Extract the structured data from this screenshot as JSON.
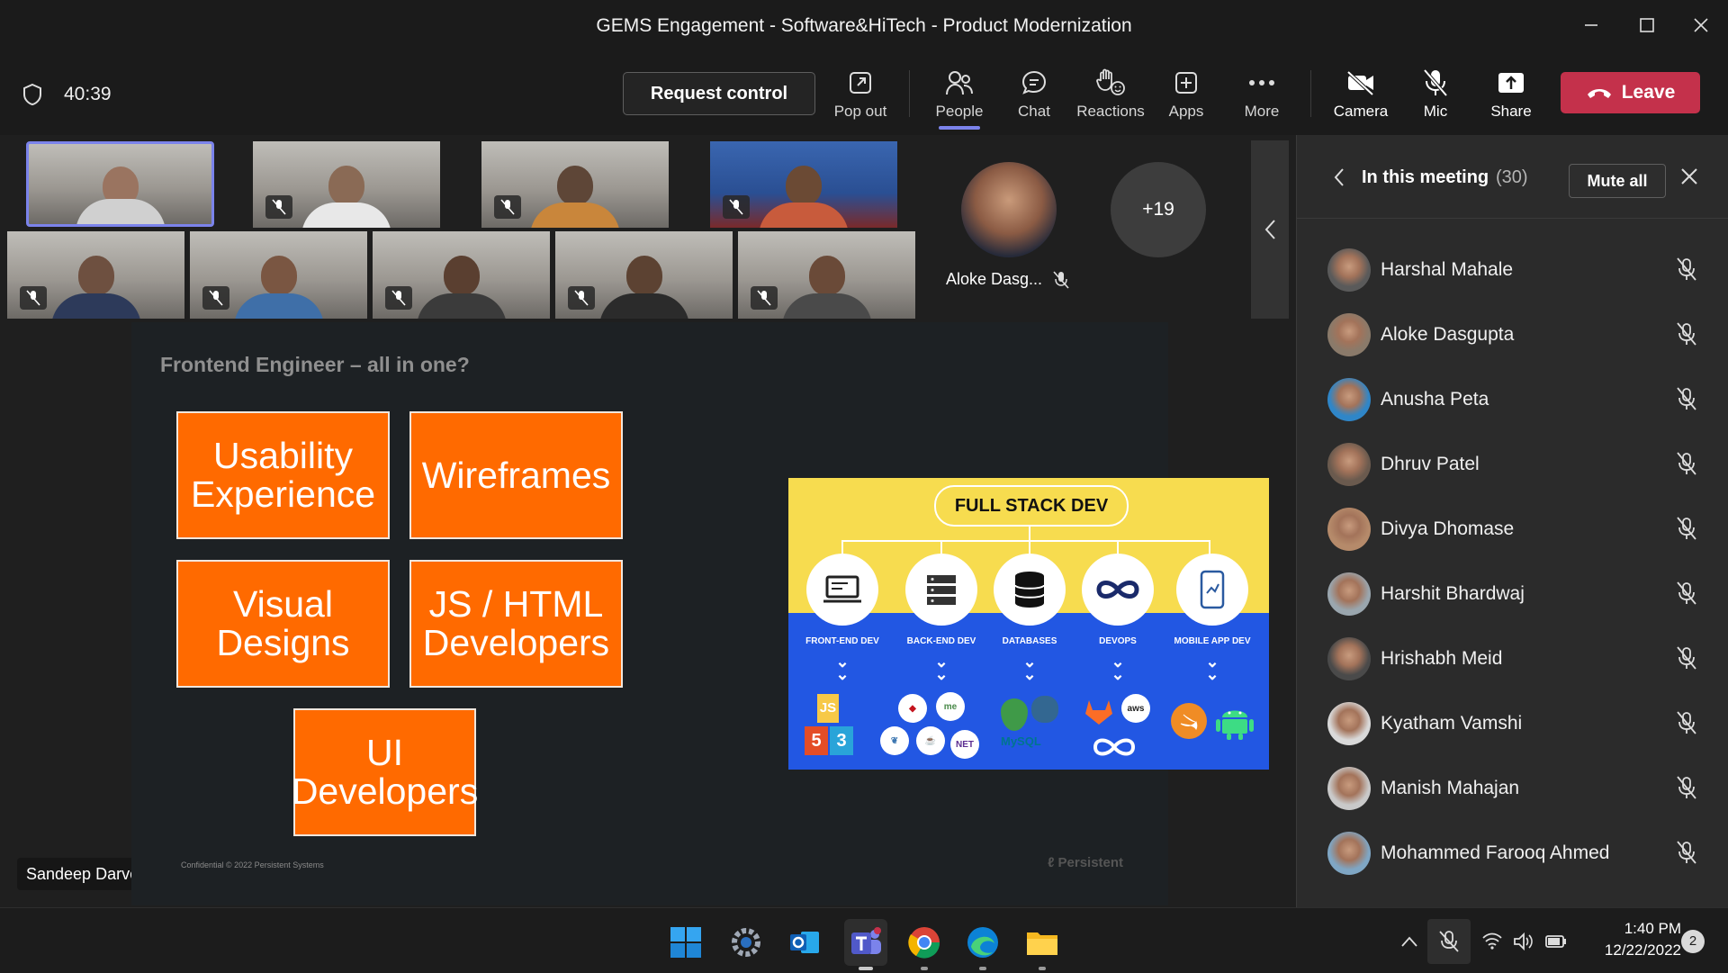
{
  "window": {
    "title": "GEMS Engagement - Software&HiTech - Product Modernization",
    "controls": [
      "minimize",
      "maximize",
      "close"
    ]
  },
  "toolbar": {
    "timer": "40:39",
    "request_control": "Request control",
    "items": [
      {
        "label": "Pop out",
        "icon": "pop-out-icon"
      },
      {
        "label": "People",
        "icon": "people-icon",
        "active": true
      },
      {
        "label": "Chat",
        "icon": "chat-icon"
      },
      {
        "label": "Reactions",
        "icon": "reactions-icon"
      },
      {
        "label": "Apps",
        "icon": "apps-icon"
      },
      {
        "label": "More",
        "icon": "more-icon"
      },
      {
        "label": "Camera",
        "icon": "camera-off-icon"
      },
      {
        "label": "Mic",
        "icon": "mic-off-icon"
      },
      {
        "label": "Share",
        "icon": "share-icon"
      }
    ],
    "leave": "Leave",
    "accent": "#7b83eb",
    "leave_color": "#c4314b"
  },
  "stage": {
    "featured_name": "Aloke Dasg...",
    "overflow_count": "+19",
    "presenter_name": "Sandeep Darvekar"
  },
  "slide": {
    "heading": "Frontend Engineer – all in one?",
    "boxes": [
      "Usability Experience",
      "Wireframes",
      "Visual Designs",
      "JS / HTML Developers",
      "UI Developers"
    ],
    "box_color": "#ff6a00",
    "full_stack": {
      "title": "FULL STACK DEV",
      "columns": [
        "FRONT-END DEV",
        "BACK-END DEV",
        "DATABASES",
        "DEVOPS",
        "MOBILE APP DEV"
      ],
      "logo_text": {
        "frontend_js": "JS",
        "frontend_html": "5",
        "frontend_css": "3",
        "dotnet": "NET",
        "mysql": "MySQL",
        "aws": "aws"
      }
    },
    "footer_left": "Confidential © 2022 Persistent Systems",
    "footer_brand": "Persistent"
  },
  "panel": {
    "title": "In this meeting",
    "count": "(30)",
    "mute_all": "Mute all",
    "participants": [
      {
        "name": "Harshal Mahale",
        "avatar_color": "#5a5a5a"
      },
      {
        "name": "Aloke Dasgupta",
        "avatar_color": "#8a7a6a"
      },
      {
        "name": "Anusha Peta",
        "avatar_color": "#2f86c8"
      },
      {
        "name": "Dhruv Patel",
        "avatar_color": "#6a5a4e"
      },
      {
        "name": "Divya Dhomase",
        "avatar_color": "#b58a6a"
      },
      {
        "name": "Harshit Bhardwaj",
        "avatar_color": "#9aa6ae"
      },
      {
        "name": "Hrishabh Meid",
        "avatar_color": "#4a4a4a"
      },
      {
        "name": "Kyatham Vamshi",
        "avatar_color": "#d9d9d9"
      },
      {
        "name": "Manish Mahajan",
        "avatar_color": "#c9c9c9"
      },
      {
        "name": "Mohammed Farooq Ahmed",
        "avatar_color": "#7fa6c4"
      }
    ]
  },
  "taskbar": {
    "time": "1:40 PM",
    "date": "12/22/2022",
    "notifications": "2",
    "apps": [
      "start-icon",
      "settings-icon",
      "outlook-icon",
      "teams-icon",
      "chrome-icon",
      "edge-icon",
      "file-explorer-icon"
    ]
  }
}
